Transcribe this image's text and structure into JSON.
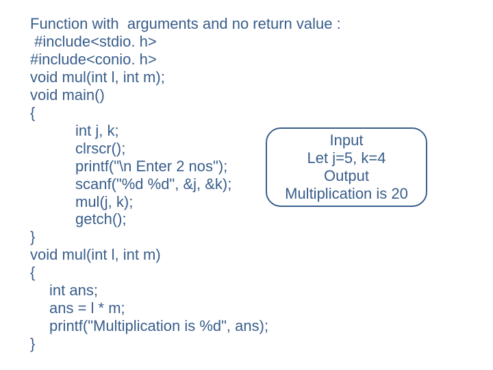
{
  "code": {
    "l1": "Function with  arguments and no return value :",
    "l2": " #include<stdio. h>",
    "l3": "#include<conio. h>",
    "l4": "void mul(int l, int m);",
    "l5": "void main()",
    "l6": "{",
    "l7": "int j, k;",
    "l8": "clrscr();",
    "l9": "printf(\"\\n Enter 2 nos\");",
    "l10": "scanf(\"%d %d\", &j, &k);",
    "l11": "mul(j, k);",
    "l12": "getch();",
    "l13": "}",
    "l14": "void mul(int l, int m)",
    "l15": "{",
    "l16": "int ans;",
    "l17": "ans = l * m;",
    "l18": "printf(\"Multiplication is %d\", ans);",
    "l19": "}"
  },
  "bubble": {
    "b1": "Input",
    "b2": "Let j=5, k=4",
    "b3": "Output",
    "b4": "Multiplication is 20"
  }
}
